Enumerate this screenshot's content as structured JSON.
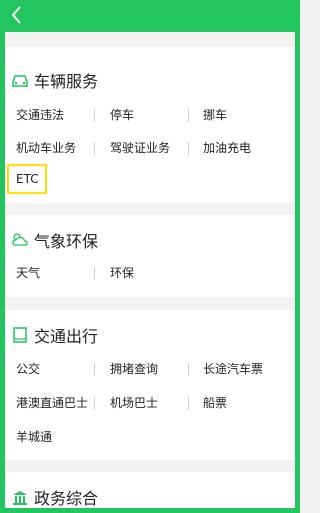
{
  "sections": [
    {
      "title": "车辆服务",
      "icon": "car-icon",
      "rows": [
        [
          "交通违法",
          "停车",
          "挪车"
        ],
        [
          "机动车业务",
          "驾驶证业务",
          "加油充电"
        ],
        [
          "ETC"
        ]
      ]
    },
    {
      "title": "气象环保",
      "icon": "weather-cloud-icon",
      "rows": [
        [
          "天气",
          "环保"
        ]
      ]
    },
    {
      "title": "交通出行",
      "icon": "book-icon",
      "rows": [
        [
          "公交",
          "拥堵查询",
          "长途汽车票"
        ],
        [
          "港澳直通巴士",
          "机场巴士",
          "船票"
        ],
        [
          "羊城通"
        ]
      ]
    },
    {
      "title": "政务综合",
      "icon": "government-building-icon",
      "rows": []
    }
  ],
  "colors": {
    "accent": "#22c55e",
    "highlight": "#ffe000"
  }
}
